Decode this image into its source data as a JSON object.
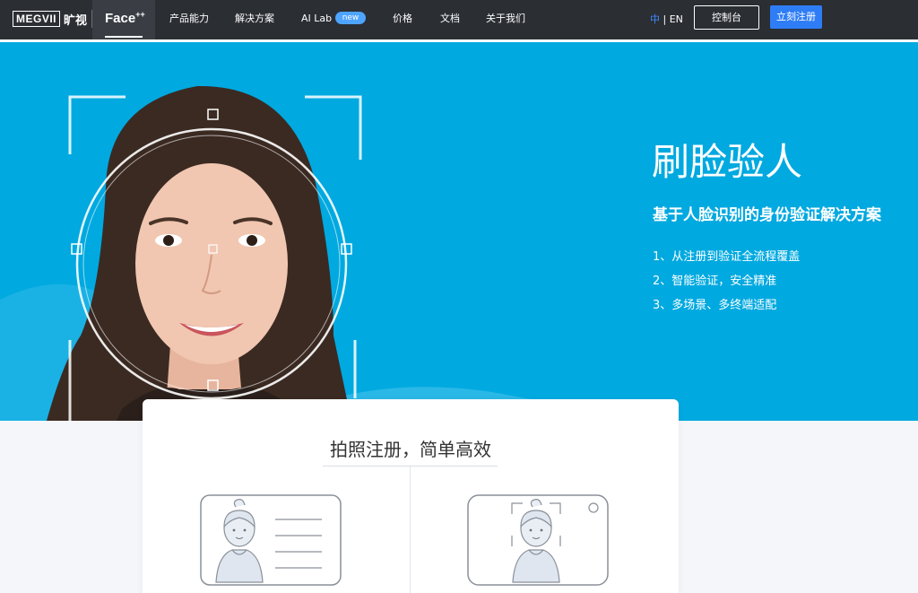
{
  "nav": {
    "logo_text": "MEGVII",
    "logo_cn": "旷视",
    "product_tab": "Face",
    "product_tab_sup": "++",
    "items": [
      {
        "label": "产品能力"
      },
      {
        "label": "解决方案"
      },
      {
        "label": "AI Lab"
      },
      {
        "label": "价格"
      },
      {
        "label": "文档"
      },
      {
        "label": "关于我们"
      }
    ],
    "new_badge": "new",
    "lang_cn": "中",
    "lang_sep": " | ",
    "lang_en": "EN",
    "console_button": "控制台",
    "register_button": "立刻注册"
  },
  "hero": {
    "title": "刷脸验人",
    "subtitle": "基于人脸识别的身份验证解决方案",
    "points": [
      "1、从注册到验证全流程覆盖",
      "2、智能验证，安全精准",
      "3、多场景、多终端适配"
    ],
    "background_color": "#00a9e0"
  },
  "card": {
    "title": "拍照注册，简单高效"
  },
  "colors": {
    "nav_bg": "#2b2e33",
    "accent": "#2e7df6",
    "badge": "#4ea4ff"
  }
}
